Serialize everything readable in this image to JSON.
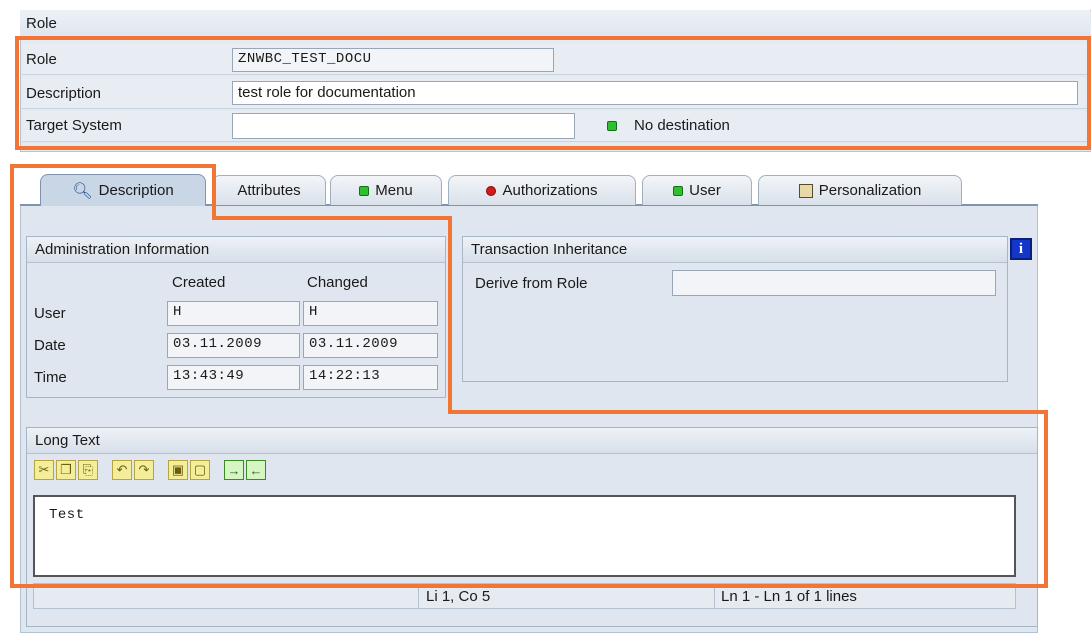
{
  "header": {
    "title": "Role",
    "rows": [
      {
        "label": "Role",
        "value": "ZNWBC_TEST_DOCU"
      },
      {
        "label": "Description",
        "value": "test role for documentation"
      },
      {
        "label": "Target System",
        "value": ""
      }
    ],
    "destination_status": "No destination"
  },
  "tabs": [
    {
      "label": "Description",
      "icon": "magnifier-icon",
      "active": true
    },
    {
      "label": "Attributes",
      "icon": "",
      "active": false
    },
    {
      "label": "Menu",
      "icon": "green-led-icon",
      "active": false
    },
    {
      "label": "Authorizations",
      "icon": "red-status-icon",
      "active": false
    },
    {
      "label": "User",
      "icon": "green-led-icon",
      "active": false
    },
    {
      "label": "Personalization",
      "icon": "personalization-icon",
      "active": false
    }
  ],
  "admin_info": {
    "title": "Administration Information",
    "col_created": "Created",
    "col_changed": "Changed",
    "rows": [
      {
        "label": "User",
        "created": "H",
        "changed": "H"
      },
      {
        "label": "Date",
        "created": "03.11.2009",
        "changed": "03.11.2009"
      },
      {
        "label": "Time",
        "created": "13:43:49",
        "changed": "14:22:13"
      }
    ]
  },
  "transaction_inheritance": {
    "title": "Transaction Inheritance",
    "derive_label": "Derive from Role",
    "derive_value": "",
    "info_icon_text": "i"
  },
  "long_text": {
    "title": "Long Text",
    "toolbar": [
      "cut-icon",
      "copy-icon",
      "paste-icon",
      "undo-icon",
      "redo-icon",
      "find-icon",
      "find-next-icon",
      "import-icon",
      "export-icon"
    ],
    "content": "Test",
    "status_position": "Li 1, Co 5",
    "status_lines": "Ln 1 - Ln 1 of 1 lines"
  },
  "colors": {
    "highlight": "#f27535",
    "panel": "#dfe6ef",
    "led_green": "#2fbf2f"
  }
}
